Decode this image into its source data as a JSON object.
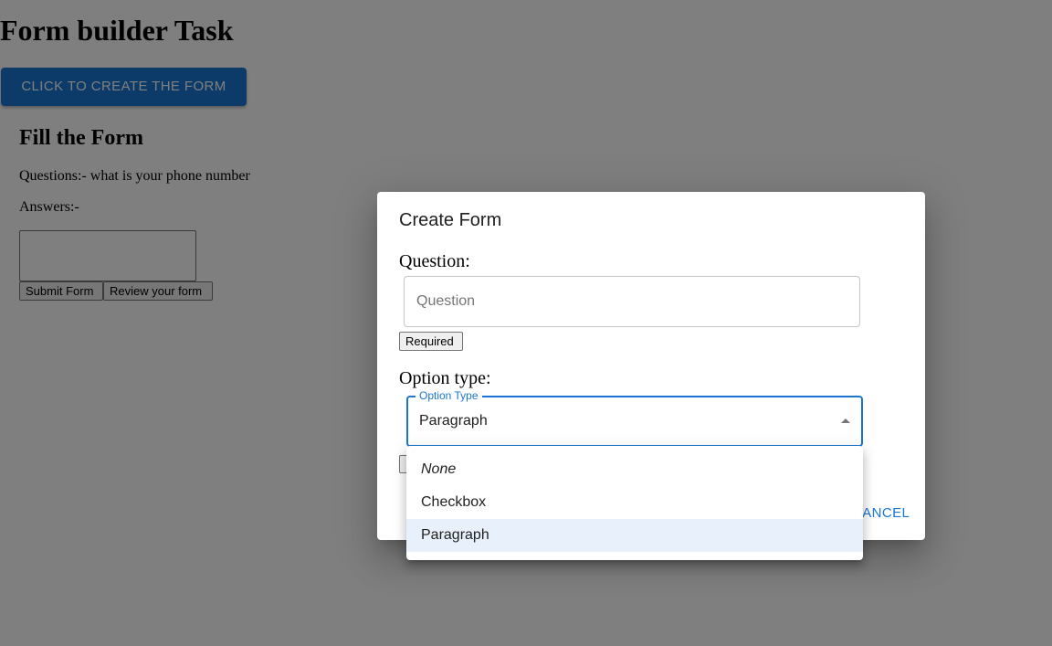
{
  "page": {
    "title": "Form builder Task",
    "create_button_label": "CLICK TO CREATE THE FORM",
    "fill_title": "Fill the Form",
    "question_line": "Questions:- what is your phone number",
    "answers_label": "Answers:-",
    "answer_value": "",
    "submit_label": "Submit Form",
    "review_label": "Review your form"
  },
  "dialog": {
    "title": "Create Form",
    "question_label": "Question:",
    "question_placeholder": "Question",
    "required_label": "Required",
    "option_type_label": "Option type:",
    "select_legend": "Option Type",
    "select_value": "Paragraph",
    "cancel_label": "CANCEL"
  },
  "menu": {
    "items": [
      {
        "label": "None"
      },
      {
        "label": "Checkbox"
      },
      {
        "label": "Paragraph",
        "selected": true
      }
    ]
  },
  "colors": {
    "primary": "#1976d2",
    "backdrop": "rgba(0,0,0,0.5)",
    "selected_item_bg": "#e8f1fb"
  },
  "icons": {
    "select_arrow": "caret-up-icon"
  }
}
